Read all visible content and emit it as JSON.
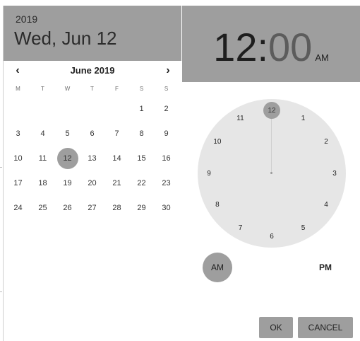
{
  "date_header": {
    "year": "2019",
    "full_date": "Wed, Jun 12"
  },
  "calendar": {
    "prev_icon": "chevron-left-icon",
    "next_icon": "chevron-right-icon",
    "prev_glyph": "‹",
    "next_glyph": "›",
    "month_label": "June 2019",
    "weekdays": [
      "M",
      "T",
      "W",
      "T",
      "F",
      "S",
      "S"
    ],
    "weeks": [
      [
        "",
        "",
        "",
        "",
        "",
        "1",
        "2"
      ],
      [
        "3",
        "4",
        "5",
        "6",
        "7",
        "8",
        "9"
      ],
      [
        "10",
        "11",
        "12",
        "13",
        "14",
        "15",
        "16"
      ],
      [
        "17",
        "18",
        "19",
        "20",
        "21",
        "22",
        "23"
      ],
      [
        "24",
        "25",
        "26",
        "27",
        "28",
        "29",
        "30"
      ]
    ],
    "selected_day": "12"
  },
  "time_header": {
    "hours": "12",
    "colon": ":",
    "minutes": "00",
    "ampm": "AM"
  },
  "clock": {
    "numbers": [
      "12",
      "1",
      "2",
      "3",
      "4",
      "5",
      "6",
      "7",
      "8",
      "9",
      "10",
      "11"
    ],
    "selected": "12"
  },
  "ampm": {
    "am_label": "AM",
    "pm_label": "PM",
    "selected": "AM"
  },
  "actions": {
    "ok_label": "OK",
    "cancel_label": "CANCEL"
  },
  "colors": {
    "header_bg": "#9e9e9e",
    "clock_face": "#e6e6e6",
    "accent": "#9e9e9e"
  }
}
